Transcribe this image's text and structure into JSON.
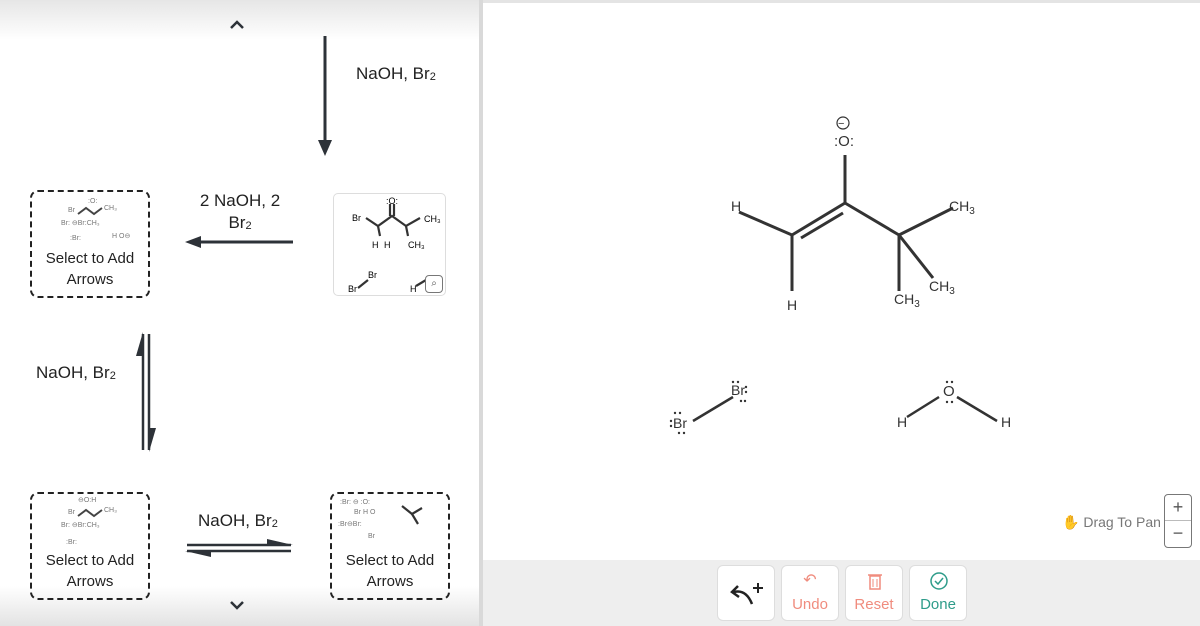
{
  "left_panel": {
    "scroll_up_icon": "chevron-up",
    "scroll_down_icon": "chevron-down",
    "reagents": {
      "top_down_arrow": {
        "label": "NaOH, Br",
        "subscript": "2"
      },
      "left_arrow": {
        "label_line1": "2 NaOH, 2",
        "label_line2": "Br",
        "subscript": "2"
      },
      "vertical_equilibrium": {
        "label": "NaOH, Br",
        "subscript": "2"
      },
      "horizontal_equilibrium": {
        "label": "NaOH, Br",
        "subscript": "2"
      }
    },
    "step_boxes": [
      {
        "label_line1": "Select to Add",
        "label_line2": "Arrows",
        "position": "top-left"
      },
      {
        "label_line1": "Select to Add",
        "label_line2": "Arrows",
        "position": "bottom-left"
      },
      {
        "label_line1": "Select to Add",
        "label_line2": "Arrows",
        "position": "bottom-right"
      }
    ],
    "thumbnail": {
      "atoms": [
        ":O:",
        "Br",
        "CH3",
        "H",
        "H",
        "CH3",
        "Br",
        "Br",
        "H",
        "O"
      ],
      "zoom_icon": "magnifier"
    },
    "mini_labels": {
      "br": "Br",
      "ch3": "CH3",
      "o": "O",
      "h": "H",
      "minus": "−"
    }
  },
  "canvas": {
    "enolate": {
      "oxygen": ":O:",
      "charge": "−",
      "labels": {
        "h_top": "H",
        "h_bottom": "H",
        "ch3_a": "CH3",
        "ch3_b": "CH3",
        "ch3_c": "CH3"
      }
    },
    "bromine": {
      "atom1": "Br",
      "atom2": "Br"
    },
    "water": {
      "oxygen": "O",
      "h_left": "H",
      "h_right": "H"
    },
    "pan_hint": "Drag To Pan",
    "zoom_in": "+",
    "zoom_out": "−"
  },
  "toolbar": {
    "add_arrow": {
      "icon": "curved-arrow-plus",
      "label": ""
    },
    "undo": {
      "label": "Undo",
      "icon": "undo-arrow",
      "color": "#f08c7e"
    },
    "reset": {
      "label": "Reset",
      "icon": "trash",
      "color": "#f08c7e"
    },
    "done": {
      "label": "Done",
      "icon": "check-circle",
      "color": "#2e9c8a"
    }
  }
}
